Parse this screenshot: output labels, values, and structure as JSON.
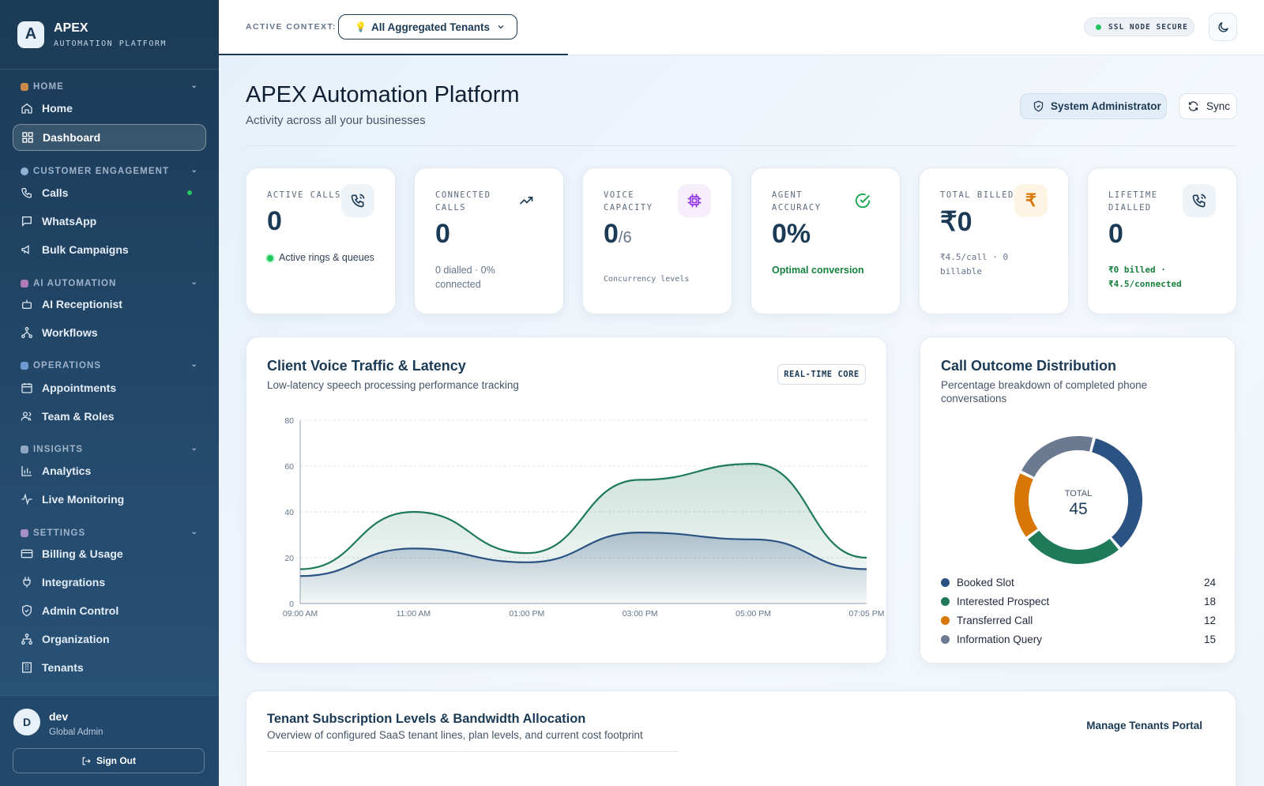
{
  "brand": {
    "name": "APEX",
    "subtitle": "AUTOMATION PLATFORM",
    "logo_letter": "A"
  },
  "sidebar": {
    "sections": [
      {
        "label": "HOME",
        "color": "#c98a4b"
      },
      {
        "label": "CUSTOMER ENGAGEMENT",
        "color": "#8fb0d4"
      },
      {
        "label": "AI AUTOMATION",
        "color": "#b07ab5"
      },
      {
        "label": "OPERATIONS",
        "color": "#6f9ad1"
      },
      {
        "label": "INSIGHTS",
        "color": "#8fa6c2"
      },
      {
        "label": "SETTINGS",
        "color": "#a58fc9"
      }
    ],
    "items": [
      {
        "label": "Home",
        "icon": "home-icon"
      },
      {
        "label": "Dashboard",
        "icon": "dashboard-icon",
        "active": true
      },
      {
        "label": "Calls",
        "icon": "phone-icon"
      },
      {
        "label": "WhatsApp",
        "icon": "chat-icon"
      },
      {
        "label": "Bulk Campaigns",
        "icon": "megaphone-icon"
      },
      {
        "label": "AI Receptionist",
        "icon": "bot-icon"
      },
      {
        "label": "Workflows",
        "icon": "workflow-icon"
      },
      {
        "label": "Appointments",
        "icon": "calendar-icon"
      },
      {
        "label": "Team & Roles",
        "icon": "users-icon"
      },
      {
        "label": "Analytics",
        "icon": "bar-chart-icon"
      },
      {
        "label": "Live Monitoring",
        "icon": "pulse-icon"
      },
      {
        "label": "Billing & Usage",
        "icon": "card-icon"
      },
      {
        "label": "Integrations",
        "icon": "plug-icon"
      },
      {
        "label": "Admin Control",
        "icon": "shield-icon"
      },
      {
        "label": "Organization",
        "icon": "org-icon"
      },
      {
        "label": "Tenants",
        "icon": "building-icon"
      }
    ],
    "profile": {
      "initial": "D",
      "name": "dev",
      "role": "Global Admin",
      "signout": "Sign Out"
    }
  },
  "header": {
    "context_label": "ACTIVE CONTEXT:",
    "context_value": "All Aggregated Tenants",
    "ssl": "SSL NODE SECURE"
  },
  "page": {
    "title": "APEX Automation Platform",
    "subtitle": "Activity across all your businesses",
    "role_button": "System Administrator",
    "sync_button": "Sync"
  },
  "kpis": [
    {
      "label": "ACTIVE CALLS",
      "value": "0",
      "note": "Active rings & queues",
      "icon": "phone-icon"
    },
    {
      "label": "CONNECTED CALLS",
      "value": "0",
      "note": "0 dialled · 0% connected",
      "icon": "trend-up-icon"
    },
    {
      "label": "VOICE CAPACITY",
      "value": "0",
      "value_suffix": "/6",
      "note": "Concurrency levels",
      "icon": "chip-icon"
    },
    {
      "label": "AGENT ACCURACY",
      "value": "0%",
      "note": "Optimal conversion",
      "icon": "check-circle-icon"
    },
    {
      "label": "TOTAL BILLED",
      "value": "₹0",
      "note": "₹4.5/call · 0 billable",
      "icon": "rupee-icon"
    },
    {
      "label": "LIFETIME DIALLED",
      "value": "0",
      "note": "₹0 billed · ₹4.5/connected",
      "icon": "phone-icon"
    }
  ],
  "traffic": {
    "title": "Client Voice Traffic & Latency",
    "subtitle": "Low-latency speech processing performance tracking",
    "badge": "REAL-TIME CORE"
  },
  "chart_data": [
    {
      "type": "area",
      "title": "Client Voice Traffic & Latency",
      "x": [
        "09:00 AM",
        "11:00 AM",
        "01:00 PM",
        "03:00 PM",
        "05:00 PM",
        "07:05 PM"
      ],
      "x_positions": [
        0,
        2,
        4,
        6,
        8,
        10
      ],
      "ylim": [
        0,
        80
      ],
      "yticks": [
        0,
        20,
        40,
        60,
        80
      ],
      "grid": true,
      "series": [
        {
          "color": "#1f7a5a",
          "x": [
            0,
            2,
            4,
            6,
            8,
            10
          ],
          "values": [
            15,
            40,
            22,
            54,
            61,
            20
          ]
        },
        {
          "color": "#2a5283",
          "x": [
            0,
            2,
            4,
            6,
            8,
            10
          ],
          "values": [
            12,
            24,
            18,
            31,
            28,
            15
          ]
        }
      ]
    },
    {
      "type": "pie",
      "title": "Call Outcome Distribution",
      "subtitle": "Percentage breakdown of completed phone conversations",
      "center_label": "TOTAL",
      "center_value": "45",
      "categories": [
        "Booked Slot",
        "Interested Prospect",
        "Transferred Call",
        "Information Query"
      ],
      "values": [
        24,
        18,
        12,
        15
      ],
      "colors": [
        "#2a5283",
        "#1f7a5a",
        "#d97706",
        "#6b7a90"
      ]
    }
  ],
  "tenants": {
    "title": "Tenant Subscription Levels & Bandwidth Allocation",
    "subtitle": "Overview of configured SaaS tenant lines, plan levels, and current cost footprint",
    "link": "Manage Tenants Portal"
  }
}
